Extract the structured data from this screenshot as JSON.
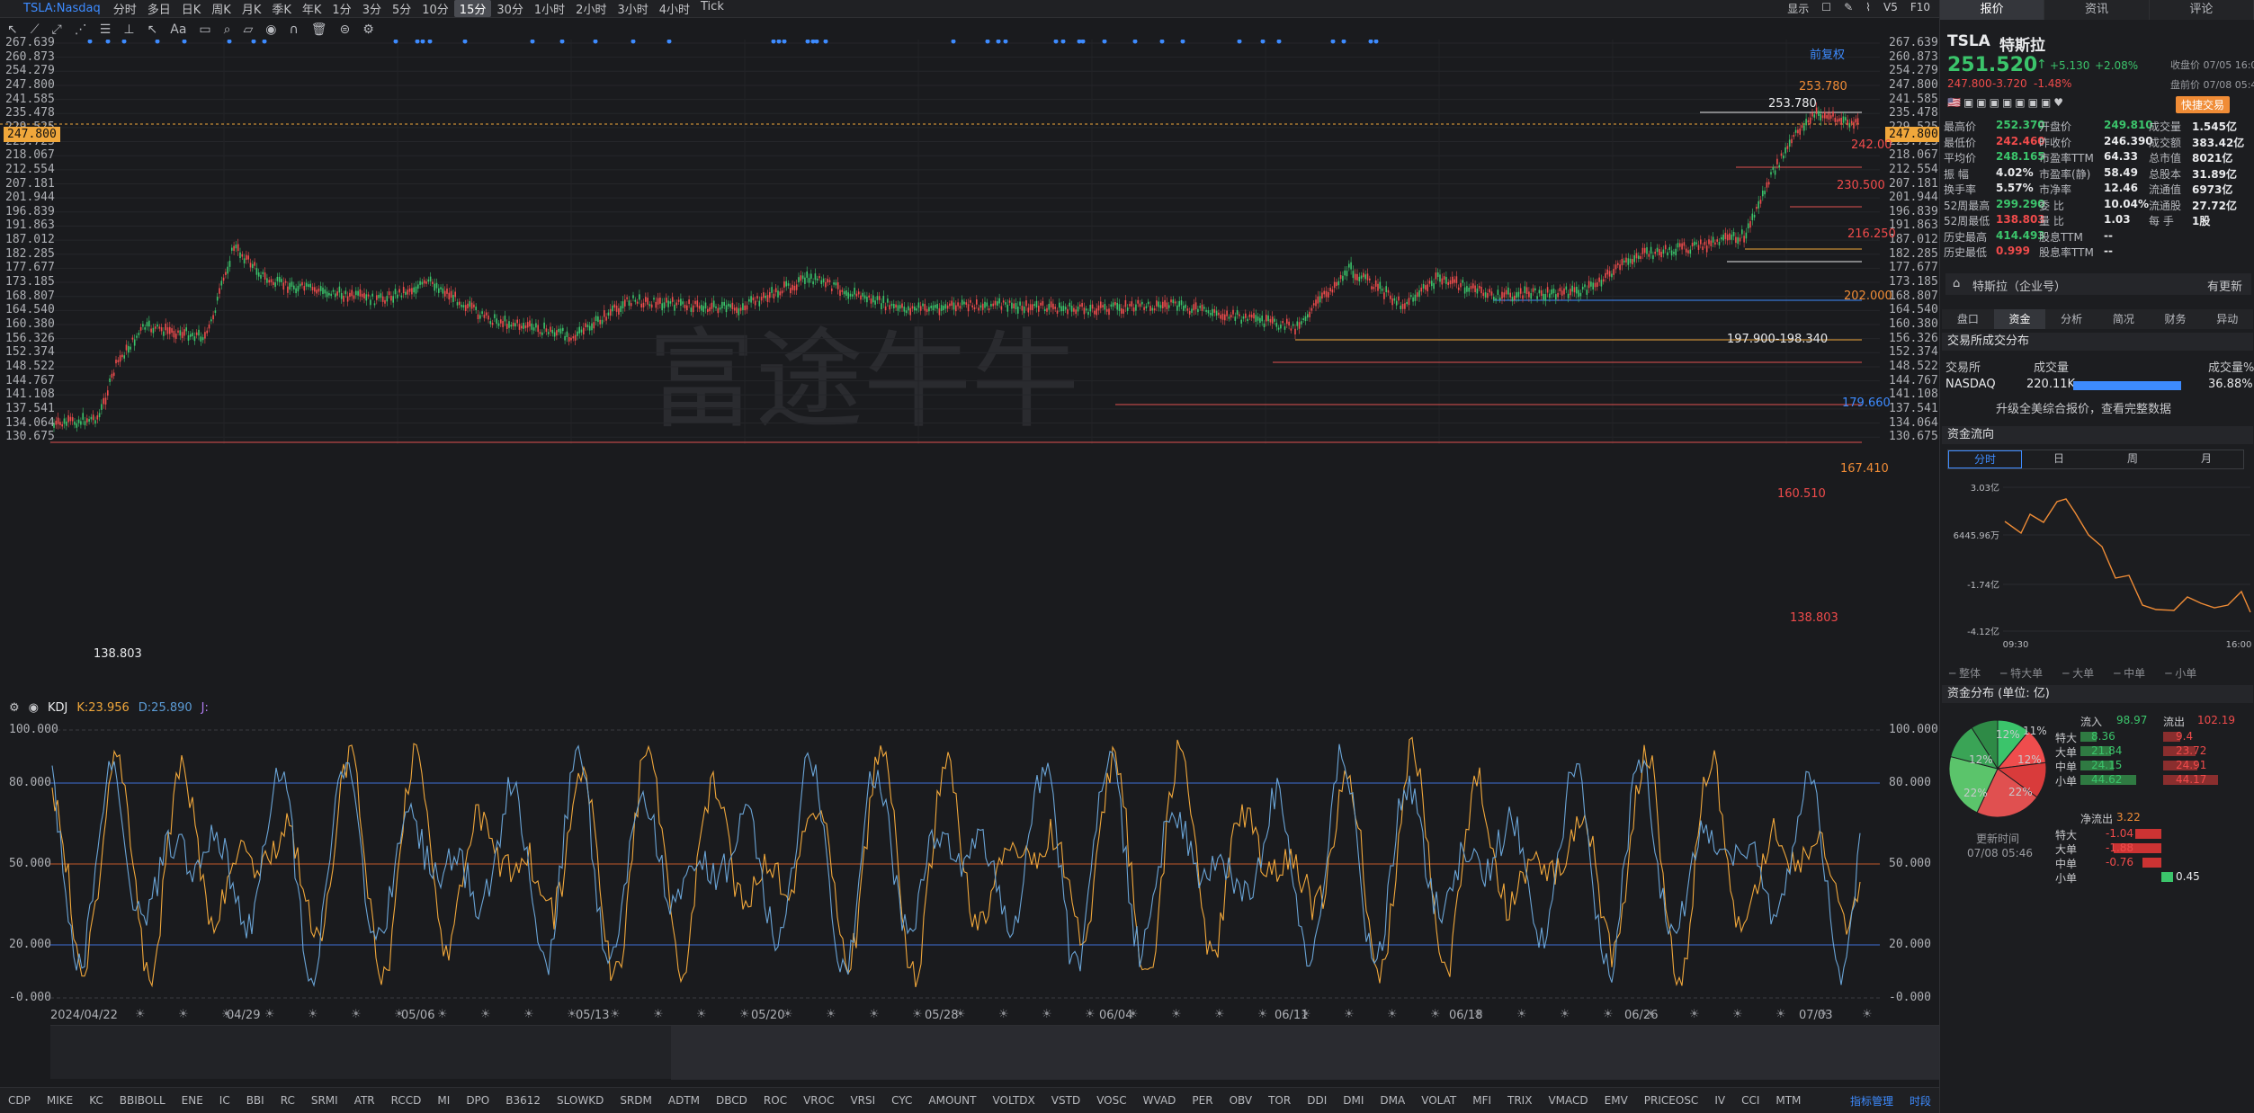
{
  "topbar": {
    "symbol": "TSLA:Nasdaq",
    "timeframes": [
      "分时",
      "多日",
      "日K",
      "周K",
      "月K",
      "季K",
      "年K",
      "1分",
      "3分",
      "5分",
      "10分",
      "15分",
      "30分",
      "1小时",
      "2小时",
      "3小时",
      "4小时",
      "Tick"
    ],
    "active_timeframe": "15分",
    "right_items": [
      "显示",
      "V5",
      "F10"
    ]
  },
  "chart": {
    "watermark": "富途牛牛",
    "adjust_label": "前复权",
    "y_labels": [
      "267.639",
      "260.873",
      "254.279",
      "247.800",
      "241.585",
      "235.478",
      "229.525",
      "223.723",
      "218.067",
      "212.554",
      "207.181",
      "201.944",
      "196.839",
      "191.863",
      "187.012",
      "182.285",
      "177.677",
      "173.185",
      "168.807",
      "164.540",
      "160.380",
      "156.326",
      "152.374",
      "148.522",
      "144.767",
      "141.108",
      "137.541",
      "134.064",
      "130.675"
    ],
    "current_price": "247.800",
    "annotations": [
      "253.780",
      "253.780",
      "242.00",
      "230.500",
      "216.250",
      "202.000",
      "197.900-198.340",
      "179.660",
      "167.410",
      "160.510",
      "138.803",
      "138.803"
    ],
    "x_labels": [
      "2024/04/22",
      "04/29",
      "05/06",
      "05/13",
      "05/20",
      "05/28",
      "06/04",
      "06/11",
      "06/18",
      "06/26",
      "07/03"
    ]
  },
  "indicator": {
    "name": "KDJ",
    "k_label": "K:23.956",
    "d_label": "D:25.890",
    "j_label": "J:",
    "y_labels": [
      "100.000",
      "80.000",
      "50.000",
      "20.000",
      "-0.000"
    ]
  },
  "bottom_indicators": [
    "CDP",
    "MIKE",
    "KC",
    "BBIBOLL",
    "ENE",
    "IC",
    "BBI",
    "RC",
    "SRMI",
    "ATR",
    "RCCD",
    "MI",
    "DPO",
    "B3612",
    "SLOWKD",
    "SRDM",
    "ADTM",
    "DBCD",
    "ROC",
    "VROC",
    "VRSI",
    "CYC",
    "AMOUNT",
    "VOLTDX",
    "VSTD",
    "VOSC",
    "WVAD",
    "PER",
    "OBV",
    "TOR",
    "DDI",
    "DMI",
    "DMA",
    "VOLAT",
    "MFI",
    "TRIX",
    "VMACD",
    "EMV",
    "PRICEOSC",
    "IV",
    "CCI",
    "MTM"
  ],
  "bottom_right": [
    "指标管理",
    "时段"
  ],
  "panel": {
    "tabs": [
      "报价",
      "资讯",
      "评论"
    ],
    "ticker": "TSLA",
    "name": "特斯拉",
    "price": "251.520",
    "change": "+5.130",
    "change_pct": "+2.08%",
    "close_time": "收盘价 07/05 16:00",
    "pre_price": "247.800",
    "pre_change": "-3.720",
    "pre_pct": "-1.48%",
    "pre_time": "盘前价 07/08 05:46",
    "quick_trade": "快捷交易",
    "stats": [
      [
        "最高价",
        "252.370"
      ],
      [
        "开盘价",
        "249.810"
      ],
      [
        "成交量",
        "1.545亿"
      ],
      [
        "最低价",
        "242.460"
      ],
      [
        "昨收价",
        "246.390"
      ],
      [
        "成交额",
        "383.42亿"
      ],
      [
        "平均价",
        "248.165"
      ],
      [
        "市盈率TTM",
        "64.33"
      ],
      [
        "总市值",
        "8021亿"
      ],
      [
        "振    幅",
        "4.02%"
      ],
      [
        "市盈率(静)",
        "58.49"
      ],
      [
        "总股本",
        "31.89亿"
      ],
      [
        "换手率",
        "5.57%"
      ],
      [
        "市净率",
        "12.46"
      ],
      [
        "流通值",
        "6973亿"
      ],
      [
        "52周最高",
        "299.290"
      ],
      [
        "委    比",
        "10.04%"
      ],
      [
        "流通股",
        "27.72亿"
      ],
      [
        "52周最低",
        "138.803"
      ],
      [
        "量    比",
        "1.03"
      ],
      [
        "每    手",
        "1股"
      ],
      [
        "历史最高",
        "414.493"
      ],
      [
        "股息TTM",
        "--"
      ],
      [
        "",
        ""
      ],
      [
        "历史最低",
        "0.999"
      ],
      [
        "股息率TTM",
        "--"
      ],
      [
        "",
        ""
      ]
    ],
    "company": "特斯拉（企业号）",
    "company_update": "有更新",
    "subtabs": [
      "盘口",
      "资金",
      "分析",
      "简况",
      "财务",
      "异动"
    ],
    "exchange_title": "交易所成交分布",
    "exchange_headers": [
      "交易所",
      "成交量",
      "成交量%"
    ],
    "exchange_row": [
      "NASDAQ",
      "220.11K",
      "36.88%"
    ],
    "upgrade": "升级全美综合报价，查看完整数据",
    "flow_title": "资金流向",
    "flow_tabs": [
      "分时",
      "日",
      "周",
      "月"
    ],
    "flow_y": [
      "3.03亿",
      "6445.96万",
      "-1.74亿",
      "-4.12亿"
    ],
    "flow_x": [
      "09:30",
      "16:00"
    ],
    "flow_legend": [
      "整体",
      "特大单",
      "大单",
      "中单",
      "小单"
    ],
    "dist_title": "资金分布 (单位: 亿)",
    "inflow_label": "流入",
    "inflow": "98.97",
    "outflow_label": "流出",
    "outflow": "102.19",
    "dist_rows": [
      [
        "特大",
        "8.36",
        "9.4"
      ],
      [
        "大单",
        "21.84",
        "23.72"
      ],
      [
        "中单",
        "24.15",
        "24.91"
      ],
      [
        "小单",
        "44.62",
        "44.17"
      ]
    ],
    "pie_labels": [
      "11%",
      "12%",
      "22%",
      "12%",
      "12%",
      "22%"
    ],
    "update_label": "更新时间",
    "update_time": "07/08 05:46",
    "net_label": "净流出",
    "net_value": "3.22",
    "net_rows": [
      [
        "特大",
        "-1.04"
      ],
      [
        "大单",
        "-1.88"
      ],
      [
        "中单",
        "-0.76"
      ],
      [
        "小单",
        "0.45"
      ]
    ]
  }
}
